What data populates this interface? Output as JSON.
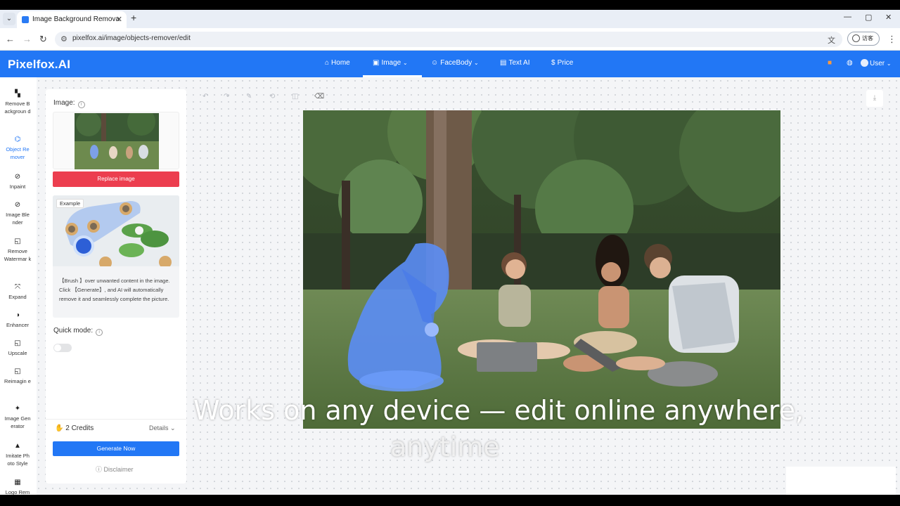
{
  "browser": {
    "tab_title": "Image Background Remova",
    "tab_close": "✕",
    "new_tab": "+",
    "url": "pixelfox.ai/image/objects-remover/edit",
    "profile_label": "访客",
    "window_controls": [
      "—",
      "▢",
      "✕"
    ]
  },
  "header": {
    "logo": "Pixelfox.AI",
    "nav": [
      {
        "label": "Home",
        "icon": "home-icon"
      },
      {
        "label": "Image",
        "icon": "image-icon"
      },
      {
        "label": "FaceBody",
        "icon": "face-icon"
      },
      {
        "label": "Text AI",
        "icon": "text-icon"
      },
      {
        "label": "Price",
        "icon": "dollar-icon"
      }
    ],
    "user_label": "User"
  },
  "rail": {
    "items": [
      {
        "label": "Remove B ackgroun d",
        "icon": "checker-icon"
      },
      {
        "label": "Object Re mover",
        "icon": "eraser-icon"
      },
      {
        "label": "Inpaint",
        "icon": "brush-icon"
      },
      {
        "label": "Image Ble nder",
        "icon": "blend-icon"
      },
      {
        "label": "Remove Watermar k",
        "icon": "watermark-icon"
      },
      {
        "label": "Expand",
        "icon": "expand-icon"
      },
      {
        "label": "Enhancer",
        "icon": "contrast-icon"
      },
      {
        "label": "Upscale",
        "icon": "upscale-icon"
      },
      {
        "label": "Reimagin e",
        "icon": "reimagine-icon"
      },
      {
        "label": "Image Gen erator",
        "icon": "sparkle-icon"
      },
      {
        "label": "Imitate Ph oto Style",
        "icon": "photo-icon"
      },
      {
        "label": "Logo Rem",
        "icon": "logo-icon"
      }
    ]
  },
  "panel": {
    "image_label": "Image:",
    "replace_button": "Replace image",
    "example_tag": "Example",
    "example_text": "【Brush 】over unwanted content in the image. Click 【Generate】, and AI will automatically remove it and seamlessly complete the picture.",
    "quick_mode_label": "Quick mode:",
    "credits": "2 Credits",
    "details": "Details",
    "generate_button": "Generate Now",
    "disclaimer": "Disclaimer"
  },
  "subtitle": {
    "line1": "Works on any device — edit online anywhere,",
    "line2": "anytime"
  },
  "colors": {
    "brand": "#2277f5",
    "danger": "#ec3e4f",
    "mask": "#5b8df5"
  }
}
